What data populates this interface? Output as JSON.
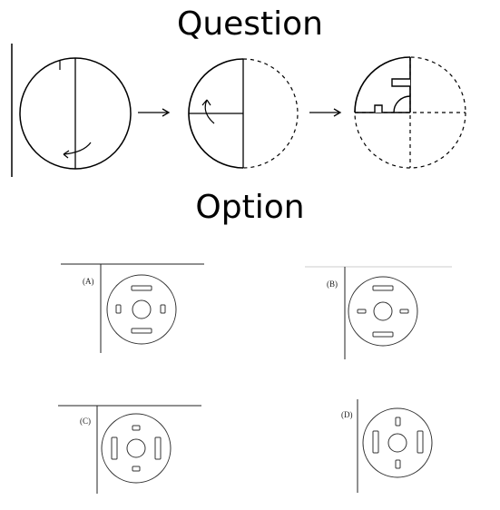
{
  "question_title": "Question",
  "option_title": "Option",
  "options": [
    {
      "label": "(A)"
    },
    {
      "label": "(B)"
    },
    {
      "label": "(C)"
    },
    {
      "label": "(D)"
    }
  ]
}
